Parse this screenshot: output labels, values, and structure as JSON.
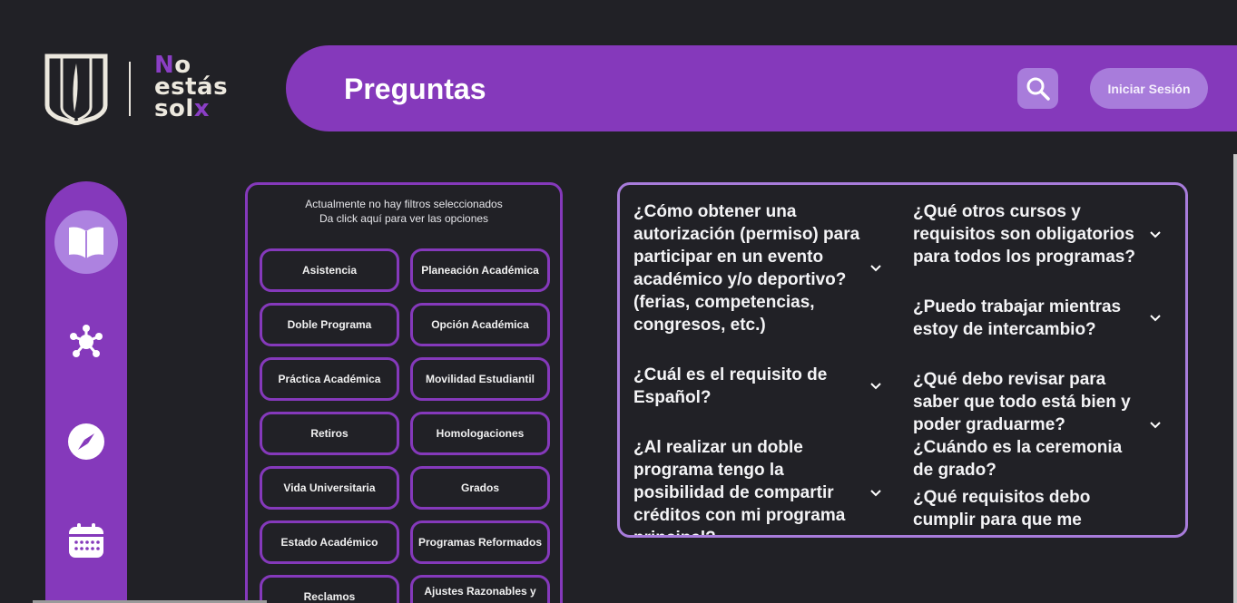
{
  "brand": {
    "wordmark_line1_accent": "N",
    "wordmark_line1_rest": "o",
    "wordmark_line2": "estás",
    "wordmark_line3_rest": "sol",
    "wordmark_line3_accent": "x"
  },
  "header": {
    "title": "Preguntas",
    "search_icon": "search-icon",
    "login_label": "Iniciar Sesión"
  },
  "sidebar": {
    "items": [
      {
        "icon": "open-book-icon",
        "active": true
      },
      {
        "icon": "network-nodes-icon",
        "active": false
      },
      {
        "icon": "compass-icon",
        "active": false
      },
      {
        "icon": "calendar-icon",
        "active": false
      }
    ]
  },
  "filters": {
    "hint_line1": "Actualmente no hay filtros seleccionados",
    "hint_line2": "Da click aquí para ver las opciones",
    "options": [
      "Asistencia",
      "Planeación Académica",
      "Doble Programa",
      "Opción Académica",
      "Práctica Académica",
      "Movilidad Estudiantil",
      "Retiros",
      "Homologaciones",
      "Vida Universitaria",
      "Grados",
      "Estado Académico",
      "Programas Reformados",
      "Reclamos",
      "Ajustes Razonables y"
    ]
  },
  "faq": {
    "questions": [
      "¿Cómo obtener una autorización (permiso) para participar en un evento académico y/o deportivo? (ferias, competencias, congresos, etc.)",
      "¿Cuál es el requisito de Español?",
      "¿Al realizar un doble programa tengo la posibilidad de compartir créditos con mi programa principal?",
      "¿Qué otros cursos y requisitos son obligatorios para todos los programas?",
      "¿Puedo trabajar mientras estoy de intercambio?",
      "¿Qué debo revisar para saber que todo está bien y poder graduarme? ¿Cuándo es la ceremonia de grado?",
      "¿Qué requisitos debo cumplir para que me reconozcan los créditos?"
    ]
  },
  "colors": {
    "background": "#212126",
    "primary_purple": "#8539bb",
    "light_purple": "#a87cdb",
    "text": "#ffffff"
  }
}
